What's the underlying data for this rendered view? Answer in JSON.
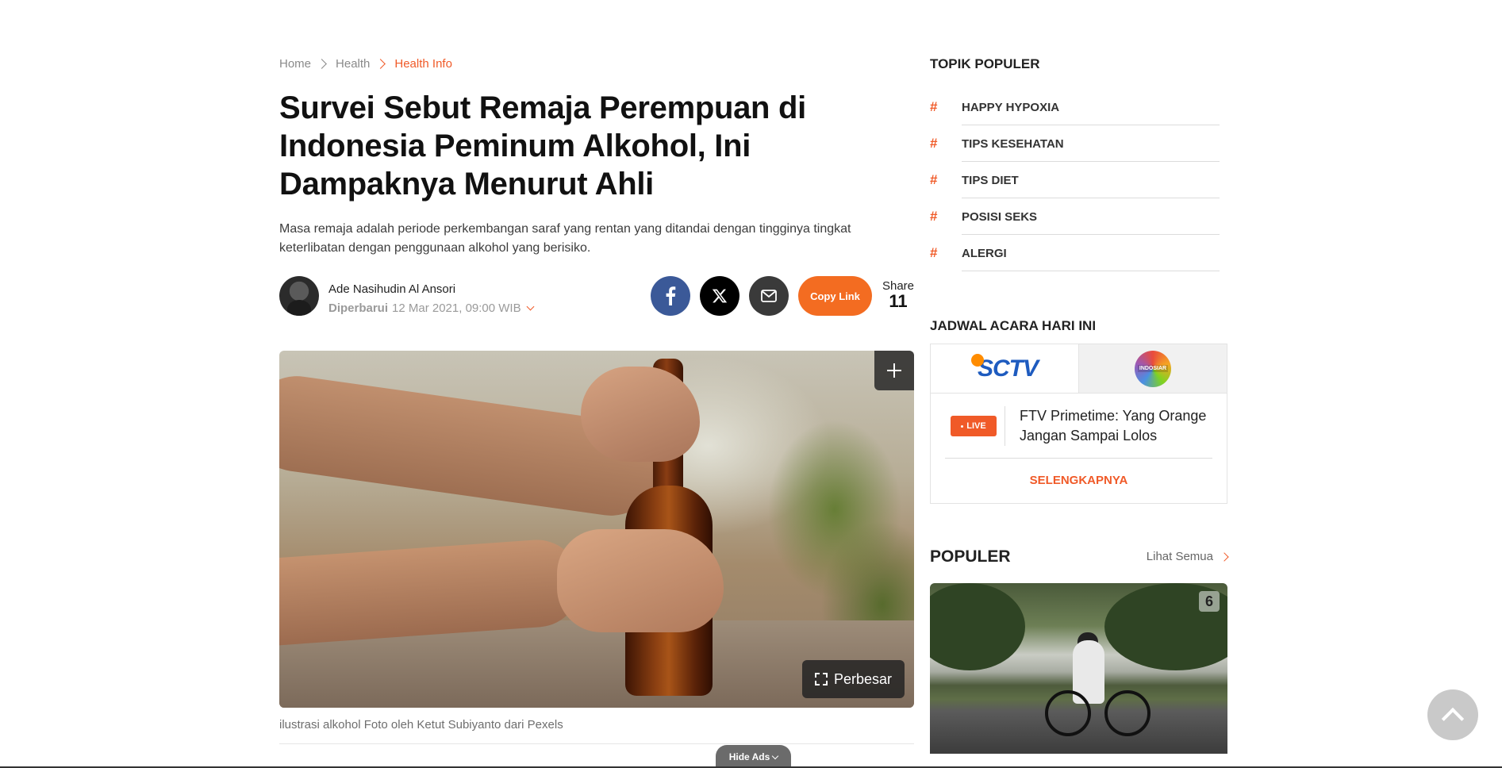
{
  "breadcrumb": {
    "items": [
      {
        "label": "Home"
      },
      {
        "label": "Health"
      },
      {
        "label": "Health Info"
      }
    ]
  },
  "article": {
    "title": "Survei Sebut Remaja Perempuan di Indonesia Peminum Alkohol, Ini Dampaknya Menurut Ahli",
    "lead": "Masa remaja adalah periode perkembangan saraf yang rentan yang ditandai dengan tingginya tingkat keterlibatan dengan penggunaan alkohol yang berisiko.",
    "author": "Ade Nasihudin Al Ansori",
    "updated_label": "Diperbarui",
    "updated_date": "12 Mar 2021, 09:00 WIB",
    "share": {
      "copy_link_label": "Copy Link",
      "share_label": "Share",
      "share_count": "11"
    },
    "image": {
      "zoom_label": "Perbesar",
      "caption": "ilustrasi alkohol Foto oleh Ketut Subiyanto dari Pexels"
    },
    "hide_ads_label": "Hide Ads"
  },
  "sidebar": {
    "topics_title": "TOPIK POPULER",
    "topics": [
      {
        "hash": "#",
        "name": "HAPPY HYPOXIA"
      },
      {
        "hash": "#",
        "name": "TIPS KESEHATAN"
      },
      {
        "hash": "#",
        "name": "TIPS DIET"
      },
      {
        "hash": "#",
        "name": "POSISI SEKS"
      },
      {
        "hash": "#",
        "name": "ALERGI"
      }
    ],
    "schedule_title": "JADWAL ACARA HARI INI",
    "schedule": {
      "channels": [
        {
          "name": "SCTV",
          "logo_text": "SCTV"
        },
        {
          "name": "INDOSIAR",
          "logo_text": "INDOSIAR"
        }
      ],
      "live_label": "LIVE",
      "now_playing": "FTV Primetime: Yang Orange Jangan Sampai Lolos",
      "more_label": "SELENGKAPNYA"
    },
    "populer_title": "POPULER",
    "see_all_label": "Lihat Semua",
    "populer_badge": "6"
  },
  "colors": {
    "accent": "#f05a28",
    "facebook": "#3b5998",
    "x": "#000000",
    "mail": "#3a3a3a",
    "copy_link": "#f36c21"
  }
}
